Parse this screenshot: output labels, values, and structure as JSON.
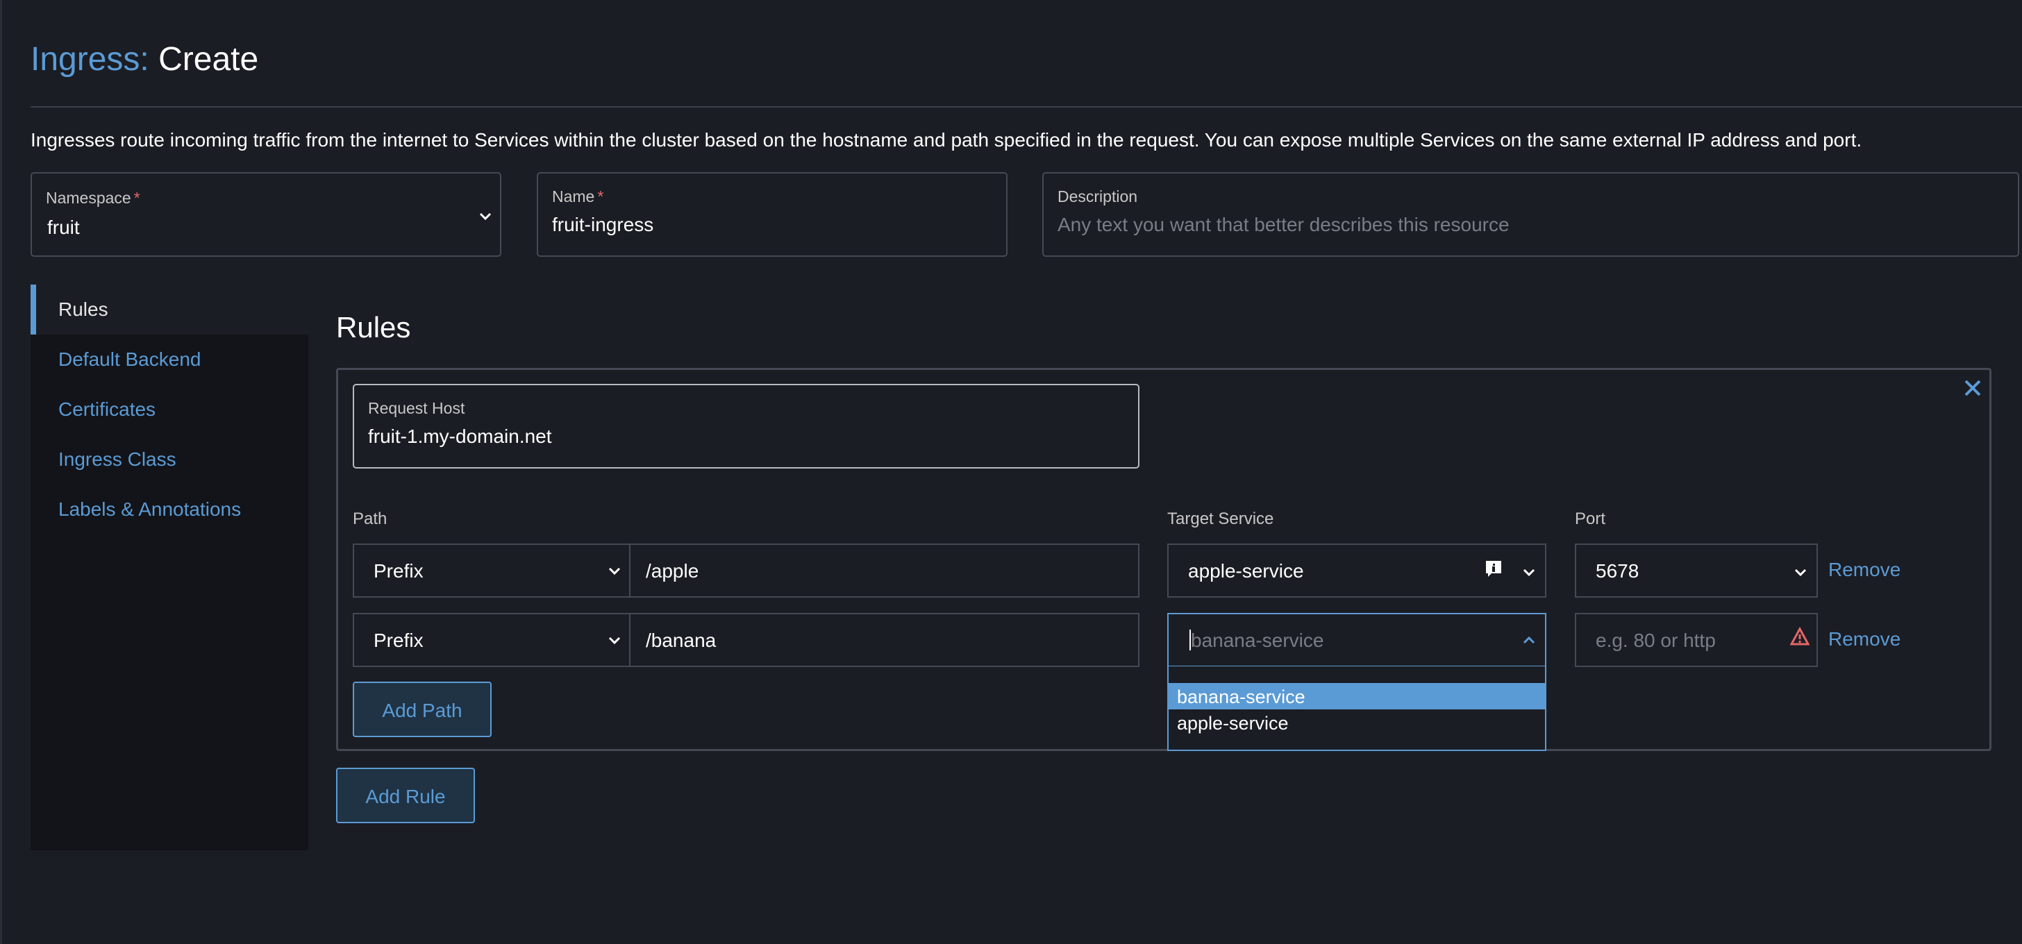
{
  "header": {
    "crumb": "Ingress:",
    "action": "Create"
  },
  "intro": "Ingresses route incoming traffic from the internet to Services within the cluster based on the hostname and path specified in the request. You can expose multiple Services on the same external IP address and port.",
  "fields": {
    "namespace": {
      "label": "Namespace",
      "required_mark": "*",
      "value": "fruit"
    },
    "name": {
      "label": "Name",
      "required_mark": "*",
      "value": "fruit-ingress"
    },
    "description": {
      "label": "Description",
      "placeholder": "Any text you want that better describes this resource"
    }
  },
  "sidebar": {
    "items": [
      {
        "label": "Rules",
        "active": true
      },
      {
        "label": "Default Backend"
      },
      {
        "label": "Certificates"
      },
      {
        "label": "Ingress Class"
      },
      {
        "label": "Labels & Annotations"
      }
    ]
  },
  "rules_section": {
    "title": "Rules",
    "request_host": {
      "label": "Request Host",
      "value": "fruit-1.my-domain.net"
    },
    "columns": {
      "path": "Path",
      "target_service": "Target Service",
      "port": "Port"
    },
    "paths": [
      {
        "type": "Prefix",
        "path": "/apple",
        "service": "apple-service",
        "port": "5678",
        "remove_label": "Remove"
      },
      {
        "type": "Prefix",
        "path": "/banana",
        "service_placeholder": "banana-service",
        "port_placeholder": "e.g. 80 or http",
        "remove_label": "Remove"
      }
    ],
    "service_options": [
      "banana-service",
      "apple-service"
    ],
    "add_path_label": "Add Path"
  },
  "add_rule_label": "Add Rule",
  "icons": {
    "chevron": "chevron-down-icon",
    "chevron_up": "chevron-up-icon",
    "close": "close-icon",
    "info": "info-icon",
    "warning": "warning-icon"
  },
  "colors": {
    "accent": "#5b9bd5",
    "background": "#1b1d24",
    "sidebar": "#131419",
    "required": "#e36767"
  }
}
